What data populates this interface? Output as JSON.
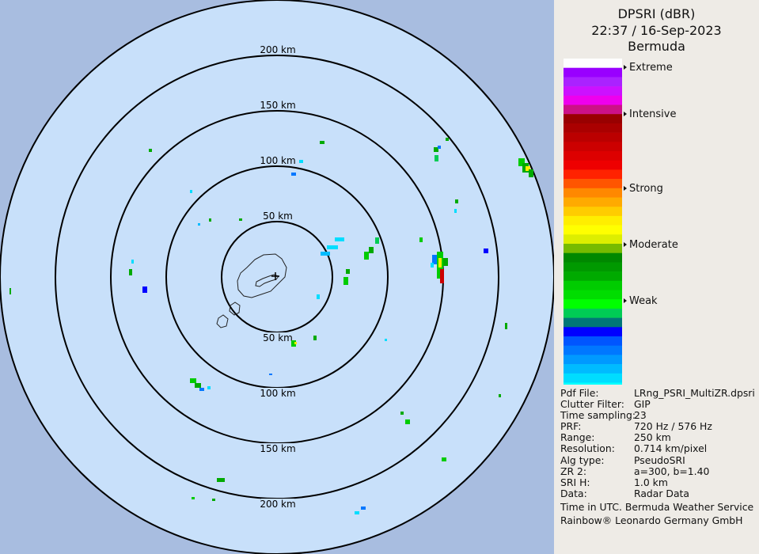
{
  "title": {
    "product": "DPSRI (dBR)",
    "timestamp": "22:37 / 16-Sep-2023",
    "site": "Bermuda"
  },
  "range_rings": [
    {
      "km": 50,
      "label": "50 km"
    },
    {
      "km": 100,
      "label": "100 km"
    },
    {
      "km": 150,
      "label": "150 km"
    },
    {
      "km": 200,
      "label": "200 km"
    }
  ],
  "legend": {
    "labels": [
      "Extreme",
      "Intensive",
      "Strong",
      "Moderate",
      "Weak"
    ],
    "colors": [
      "#ffffff",
      "#9900ff",
      "#aa22ff",
      "#cc11ff",
      "#ee00ee",
      "#cc1188",
      "#990000",
      "#aa0000",
      "#bb0000",
      "#cc0000",
      "#dd0000",
      "#ee0000",
      "#ff2200",
      "#ff5500",
      "#ff8800",
      "#ffaa00",
      "#ffcc00",
      "#ffee00",
      "#ffff00",
      "#ddee00",
      "#77bb00",
      "#008800",
      "#009900",
      "#00aa00",
      "#00cc00",
      "#00dd00",
      "#00ff00",
      "#00cc55",
      "#007777",
      "#0000ff",
      "#0055ff",
      "#0077ff",
      "#0099ff",
      "#00bbff",
      "#00ddff",
      "#00ffff",
      "#00ffff"
    ]
  },
  "metadata": [
    {
      "key": "Pdf File:",
      "value": "LRng_PSRI_MultiZR.dpsri"
    },
    {
      "key": "Clutter Filter:",
      "value": "GIP"
    },
    {
      "key": "Time sampling:",
      "value": "23"
    },
    {
      "key": "PRF:",
      "value": "720 Hz / 576 Hz"
    },
    {
      "key": "Range:",
      "value": "250 km"
    },
    {
      "key": "Resolution:",
      "value": "0.714 km/pixel"
    },
    {
      "key": "Alg type:",
      "value": "PseudoSRI"
    },
    {
      "key": "ZR 2:",
      "value": "a=300, b=1.40"
    },
    {
      "key": "SRI H:",
      "value": "1.0 km"
    },
    {
      "key": "Data:",
      "value": "Radar Data"
    }
  ],
  "footer": {
    "line1": "Time in UTC. Bermuda Weather Service",
    "line2": "Rainbow® Leonardo Germany GmbH"
  },
  "colors": {
    "coverage_fill": "#c8e0fa",
    "outside_fill": "#a8bde0",
    "panel_bg": "#eeebe6"
  }
}
